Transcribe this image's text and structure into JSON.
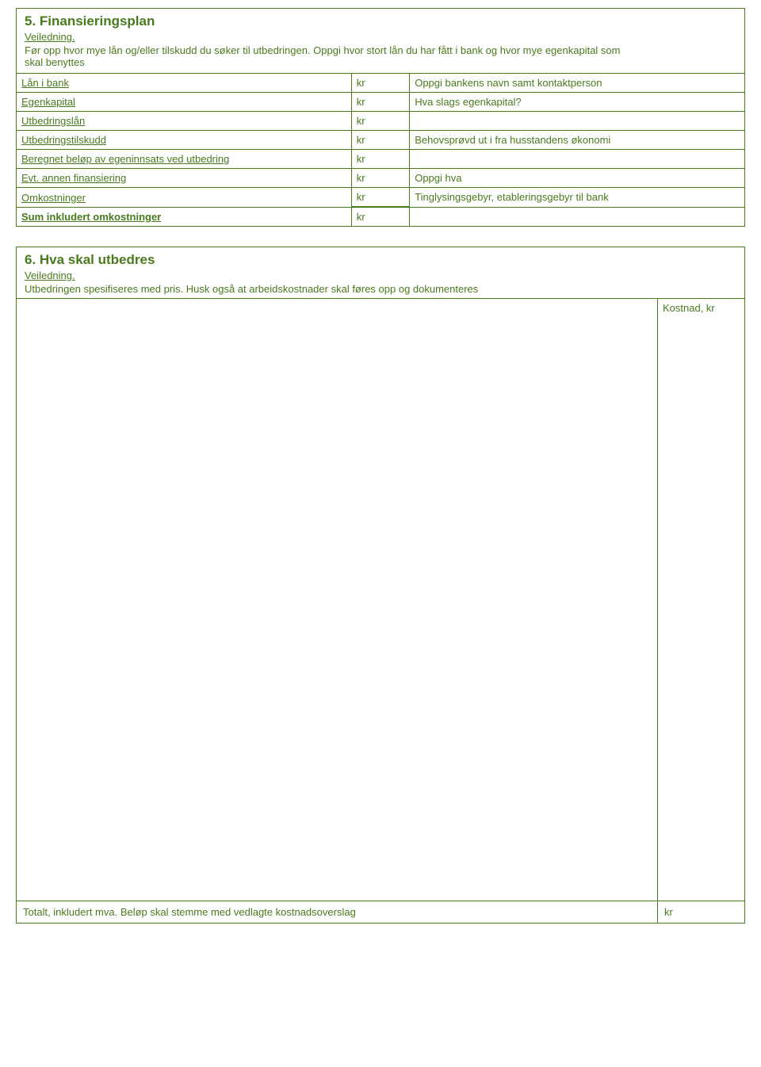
{
  "section5": {
    "title": "5.  Finansieringsplan",
    "guidanceLabel": "Veiledning.",
    "guidanceLines": [
      "Før opp hvor mye lån og/eller tilskudd du søker til utbedringen. Oppgi hvor stort lån du har fått i bank og hvor mye egenkapital som",
      "skal benyttes"
    ],
    "bankNote": "Oppgi bankens navn samt kontaktperson",
    "rows": [
      {
        "label": "Lån i bank",
        "unit": "kr",
        "note": ""
      },
      {
        "label": "Egenkapital",
        "unit": "kr",
        "note": "Hva slags egenkapital?"
      },
      {
        "label": "Utbedringslån",
        "unit": "kr",
        "note": ""
      },
      {
        "label": "Utbedringstilskudd",
        "unit": "kr",
        "note": "Behovsprøvd ut i fra husstandens økonomi"
      },
      {
        "label": "Beregnet beløp av egeninnsats ved utbedring",
        "unit": "kr",
        "note": ""
      },
      {
        "label": "Evt. annen finansiering",
        "unit": "kr",
        "note": "Oppgi hva"
      },
      {
        "label": "Omkostninger",
        "unit": "kr",
        "note": "Tinglysingsgebyr, etableringsgebyr til bank"
      },
      {
        "label": "Sum inkludert omkostninger",
        "unit": "kr",
        "note": ""
      }
    ]
  },
  "section6": {
    "title": "6.  Hva skal utbedres",
    "guidanceLabel": "Veiledning.",
    "guidanceText": "Utbedringen spesifiseres med pris. Husk også at arbeidskostnader skal føres opp og dokumenteres",
    "kostnadHeader": "Kostnad, kr",
    "footerLabel": "Totalt, inkludert mva. Beløp skal stemme med vedlagte kostnadsoverslag",
    "footerUnit": "kr"
  }
}
